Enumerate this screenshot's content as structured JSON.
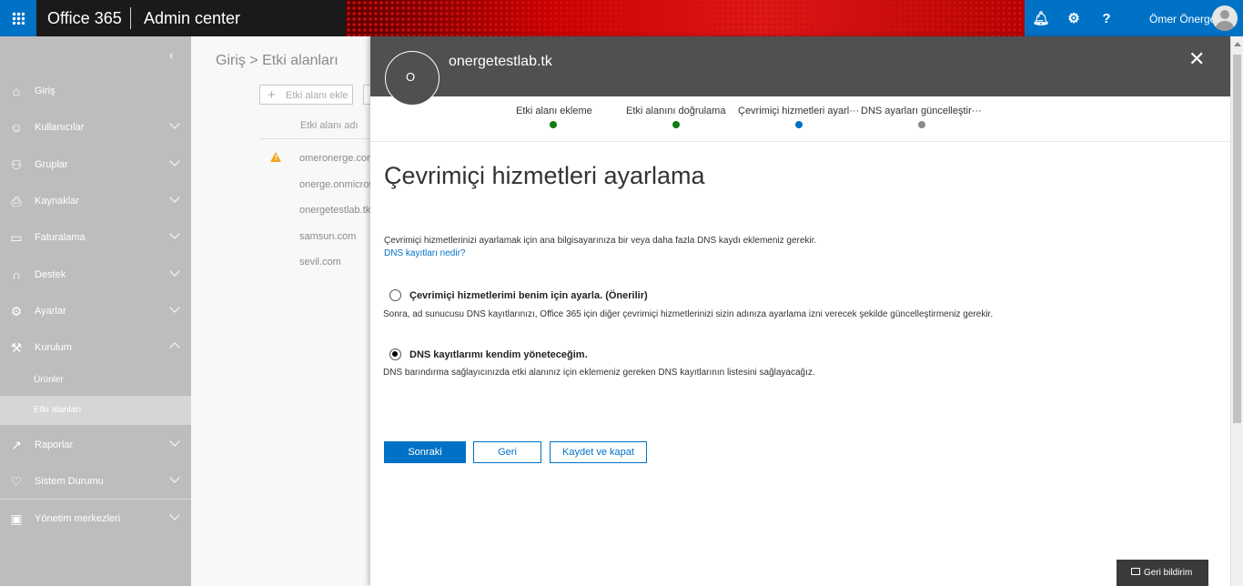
{
  "header": {
    "brand": "Office 365",
    "app_name": "Admin center",
    "user_name": "Ömer Önerge",
    "icons": [
      "waffle-icon",
      "bell-icon",
      "gear-icon",
      "help-icon",
      "avatar"
    ]
  },
  "sidebar": {
    "items": [
      {
        "label": "Giriş",
        "icon": "home-icon"
      },
      {
        "label": "Kullanıcılar",
        "icon": "user-icon"
      },
      {
        "label": "Gruplar",
        "icon": "group-icon"
      },
      {
        "label": "Kaynaklar",
        "icon": "resources-icon"
      },
      {
        "label": "Faturalama",
        "icon": "billing-icon"
      },
      {
        "label": "Destek",
        "icon": "headset-icon"
      },
      {
        "label": "Ayarlar",
        "icon": "gear-icon"
      },
      {
        "label": "Kurulum",
        "icon": "wrench-icon"
      },
      {
        "label": "Raporlar",
        "icon": "chart-icon"
      },
      {
        "label": "Sistem Durumu",
        "icon": "heart-icon"
      },
      {
        "label": "Yönetim merkezleri",
        "icon": "admin-centers-icon"
      }
    ],
    "sub_items": [
      {
        "label": "Ürünler"
      },
      {
        "label": "Etki alanları",
        "selected": true
      }
    ]
  },
  "background_page": {
    "breadcrumb": "Giriş > Etki alanları",
    "add_domain_button": "Etki alanı ekle",
    "column_header": "Etki alanı adı",
    "domains": [
      "omeronerge.com",
      "onerge.onmicrosoft.com",
      "onergetestlab.tk",
      "samsun.com",
      "sevil.com"
    ]
  },
  "panel": {
    "title": "onergetestlab.tk",
    "avatar_letter": "O",
    "steps": [
      {
        "label": "Etki alanı ekleme",
        "status": "done",
        "color": "#107c10"
      },
      {
        "label": "Etki alanını doğrulama",
        "status": "done",
        "color": "#107c10"
      },
      {
        "label": "Çevrimiçi hizmetleri ayarl···",
        "status": "current",
        "color": "#0072c6"
      },
      {
        "label": "DNS ayarları güncelleştir···",
        "status": "pending",
        "color": "#8a8a8a"
      }
    ],
    "heading": "Çevrimiçi hizmetleri ayarlama",
    "intro": "Çevrimiçi hizmetlerinizi ayarlamak için ana bilgisayarınıza bir veya daha fazla DNS kaydı eklemeniz gerekir.",
    "dns_link": "DNS kayıtları nedir?",
    "option1_label": "Çevrimiçi hizmetlerimi benim için ayarla. (Önerilir)",
    "option1_desc": "Sonra, ad sunucusu DNS kayıtlarınızı, Office 365 için diğer çevrimiçi hizmetlerinizi sizin adınıza ayarlama izni verecek şekilde güncelleştirmeniz gerekir.",
    "option2_label": "DNS kayıtlarımı kendim yöneteceğim.",
    "option2_desc": "DNS barındırma sağlayıcınızda etki alanınız için eklemeniz gereken DNS kayıtlarının listesini sağlayacağız.",
    "selected_option": 2,
    "next_button": "Sonraki",
    "back_button": "Geri",
    "save_close_button": "Kaydet ve kapat"
  },
  "feedback_button": "Geri bildirim",
  "colors": {
    "accent": "#0072c6",
    "header_dark": "#505050",
    "sidebar": "#bdbdbd"
  }
}
